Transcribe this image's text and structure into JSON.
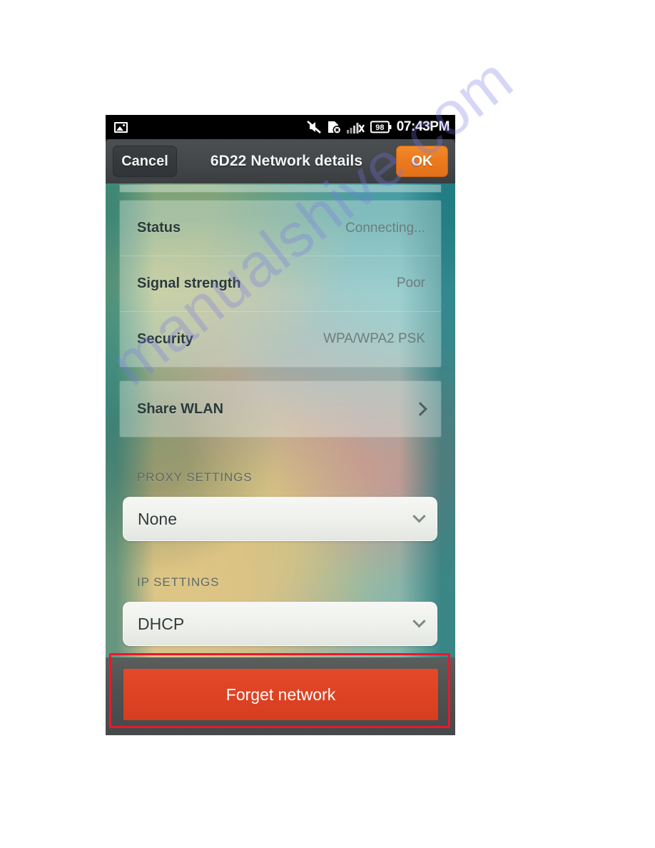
{
  "statusbar": {
    "notification_icon": "image-icon",
    "icons": [
      "vibrate-muted-icon",
      "sim-card-error-icon",
      "signal-no-service-icon",
      "battery-icon"
    ],
    "battery_level": "98",
    "time": "07:43PM"
  },
  "actionbar": {
    "cancel_label": "Cancel",
    "title": "6D22 Network details",
    "ok_label": "OK"
  },
  "info_rows": [
    {
      "label": "Status",
      "value": "Connecting..."
    },
    {
      "label": "Signal strength",
      "value": "Poor"
    },
    {
      "label": "Security",
      "value": "WPA/WPA2 PSK"
    }
  ],
  "share": {
    "label": "Share WLAN",
    "chevron": "chevron-right-icon"
  },
  "proxy": {
    "section_label": "PROXY SETTINGS",
    "selected": "None",
    "chevron": "chevron-down-icon"
  },
  "ip": {
    "section_label": "IP SETTINGS",
    "selected": "DHCP",
    "chevron": "chevron-down-icon"
  },
  "forget": {
    "label": "Forget network"
  },
  "watermark": {
    "text": "manualshive.com"
  },
  "colors": {
    "ok_button": "#ec7a1d",
    "forget_button": "#dd4223",
    "annotation": "#e8192c",
    "status_bar": "#000000",
    "action_bar": "#44484b"
  }
}
